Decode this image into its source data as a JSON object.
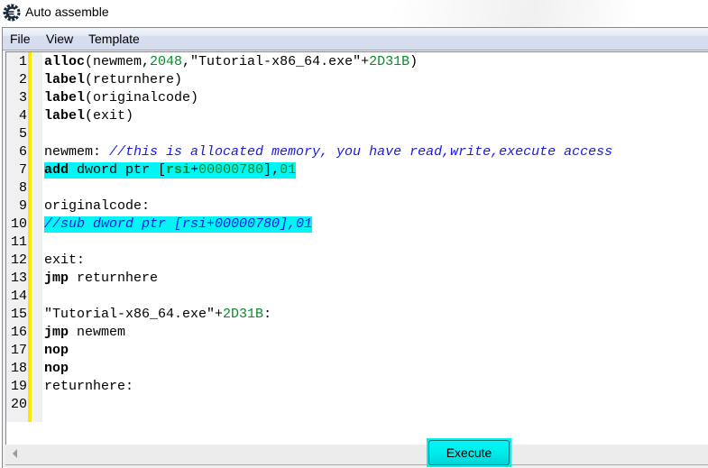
{
  "window": {
    "title": "Auto assemble",
    "icon": "cheat-engine-icon"
  },
  "menu": {
    "items": [
      {
        "label": "File"
      },
      {
        "label": "View"
      },
      {
        "label": "Template"
      }
    ]
  },
  "editor": {
    "lines": [
      {
        "n": "1",
        "highlight": false,
        "tokens": [
          {
            "t": "alloc",
            "c": "kw"
          },
          {
            "t": "(newmem,",
            "c": ""
          },
          {
            "t": "2048",
            "c": "num"
          },
          {
            "t": ",\"Tutorial-x86_64.exe\"+",
            "c": ""
          },
          {
            "t": "2D31B",
            "c": "num"
          },
          {
            "t": ")",
            "c": ""
          }
        ]
      },
      {
        "n": "2",
        "highlight": false,
        "tokens": [
          {
            "t": "label",
            "c": "kw"
          },
          {
            "t": "(returnhere)",
            "c": ""
          }
        ]
      },
      {
        "n": "3",
        "highlight": false,
        "tokens": [
          {
            "t": "label",
            "c": "kw"
          },
          {
            "t": "(originalcode)",
            "c": ""
          }
        ]
      },
      {
        "n": "4",
        "highlight": false,
        "tokens": [
          {
            "t": "label",
            "c": "kw"
          },
          {
            "t": "(exit)",
            "c": ""
          }
        ]
      },
      {
        "n": "5",
        "highlight": false,
        "tokens": []
      },
      {
        "n": "6",
        "highlight": false,
        "tokens": [
          {
            "t": "newmem: ",
            "c": ""
          },
          {
            "t": "//this is allocated memory, you have read,write,execute access",
            "c": "cmt"
          }
        ]
      },
      {
        "n": "7",
        "highlight": true,
        "tokens": [
          {
            "t": "add",
            "c": "kw"
          },
          {
            "t": " dword ptr [",
            "c": ""
          },
          {
            "t": "rsi",
            "c": "reg"
          },
          {
            "t": "+",
            "c": ""
          },
          {
            "t": "00000780",
            "c": "num"
          },
          {
            "t": "],",
            "c": ""
          },
          {
            "t": "01",
            "c": "num"
          }
        ]
      },
      {
        "n": "8",
        "highlight": false,
        "tokens": []
      },
      {
        "n": "9",
        "highlight": false,
        "tokens": [
          {
            "t": "originalcode:",
            "c": ""
          }
        ]
      },
      {
        "n": "10",
        "highlight": true,
        "tokens": [
          {
            "t": "//sub dword ptr [rsi+00000780],01",
            "c": "cmt"
          }
        ]
      },
      {
        "n": "11",
        "highlight": false,
        "tokens": []
      },
      {
        "n": "12",
        "highlight": false,
        "tokens": [
          {
            "t": "exit:",
            "c": ""
          }
        ]
      },
      {
        "n": "13",
        "highlight": false,
        "tokens": [
          {
            "t": "jmp",
            "c": "kw"
          },
          {
            "t": " returnhere",
            "c": ""
          }
        ]
      },
      {
        "n": "14",
        "highlight": false,
        "tokens": []
      },
      {
        "n": "15",
        "highlight": false,
        "tokens": [
          {
            "t": "\"Tutorial-x86_64.exe\"+",
            "c": ""
          },
          {
            "t": "2D31B",
            "c": "num"
          },
          {
            "t": ":",
            "c": ""
          }
        ]
      },
      {
        "n": "16",
        "highlight": false,
        "tokens": [
          {
            "t": "jmp",
            "c": "kw"
          },
          {
            "t": " newmem",
            "c": ""
          }
        ]
      },
      {
        "n": "17",
        "highlight": false,
        "tokens": [
          {
            "t": "nop",
            "c": "kw"
          }
        ]
      },
      {
        "n": "18",
        "highlight": false,
        "tokens": [
          {
            "t": "nop",
            "c": "kw"
          }
        ]
      },
      {
        "n": "19",
        "highlight": false,
        "tokens": [
          {
            "t": "returnhere:",
            "c": ""
          }
        ]
      },
      {
        "n": "20",
        "highlight": false,
        "tokens": []
      }
    ]
  },
  "footer": {
    "execute_label": "Execute"
  },
  "colors": {
    "highlight": "#00f5f5",
    "gutter_marker": "#ffe600",
    "number": "#0a8a2c",
    "comment": "#1a1ae0"
  }
}
